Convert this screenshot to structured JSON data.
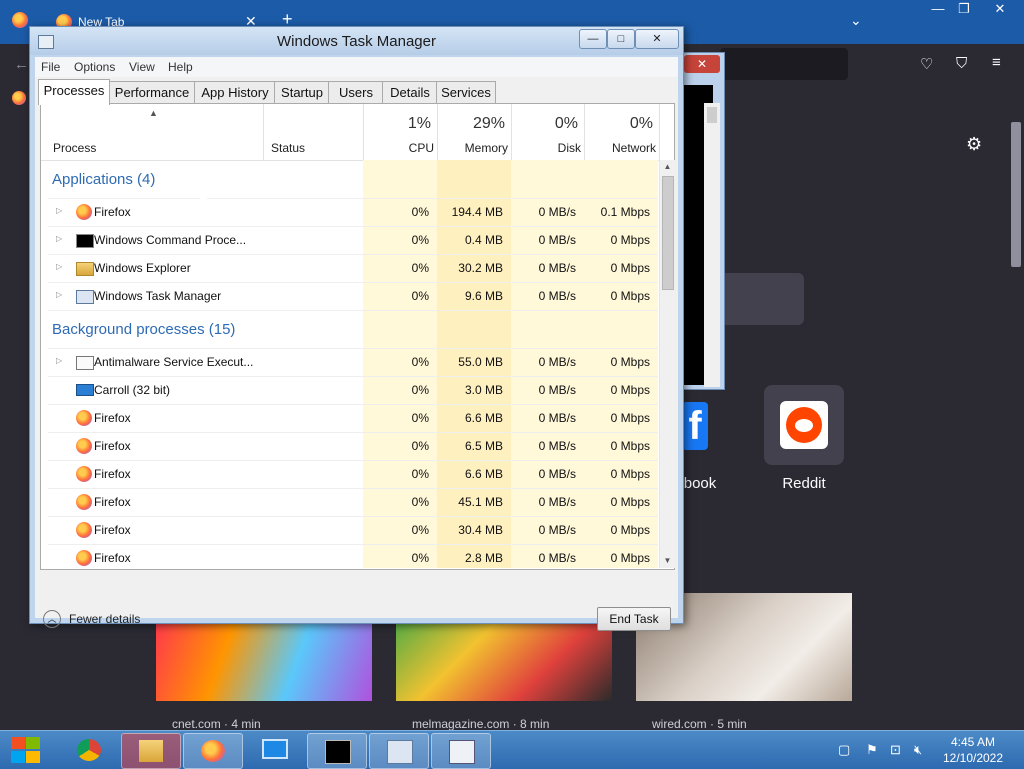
{
  "firefox": {
    "tab_title": "New Tab",
    "tile_reddit": "Reddit",
    "tile_facebook_partial": "book",
    "stories": [
      {
        "source": "cnet.com · 4 min"
      },
      {
        "source": "melmagazine.com · 8 min"
      },
      {
        "source": "wired.com · 5 min"
      }
    ]
  },
  "taskmgr": {
    "title": "Windows Task Manager",
    "menu": [
      "File",
      "Options",
      "View",
      "Help"
    ],
    "tabs": [
      "Processes",
      "Performance",
      "App History",
      "Startup",
      "Users",
      "Details",
      "Services"
    ],
    "columns": {
      "process": "Process",
      "status": "Status",
      "cpu": {
        "pct": "1%",
        "name": "CPU"
      },
      "memory": {
        "pct": "29%",
        "name": "Memory"
      },
      "disk": {
        "pct": "0%",
        "name": "Disk"
      },
      "network": {
        "pct": "0%",
        "name": "Network"
      }
    },
    "groups": {
      "apps": "Applications (4)",
      "background": "Background processes (15)"
    },
    "apps": [
      {
        "name": "Firefox",
        "icon": "firefox-icon",
        "cpu": "0%",
        "mem": "194.4 MB",
        "disk": "0 MB/s",
        "net": "0.1 Mbps"
      },
      {
        "name": "Windows Command Proce...",
        "icon": "cmd-icon",
        "cpu": "0%",
        "mem": "0.4 MB",
        "disk": "0 MB/s",
        "net": "0 Mbps"
      },
      {
        "name": "Windows Explorer",
        "icon": "explorer-icon",
        "cpu": "0%",
        "mem": "30.2 MB",
        "disk": "0 MB/s",
        "net": "0 Mbps"
      },
      {
        "name": "Windows Task Manager",
        "icon": "taskmgr-icon",
        "cpu": "0%",
        "mem": "9.6 MB",
        "disk": "0 MB/s",
        "net": "0 Mbps"
      }
    ],
    "background": [
      {
        "name": "Antimalware Service Execut...",
        "icon": "service-icon",
        "cpu": "0%",
        "mem": "55.0 MB",
        "disk": "0 MB/s",
        "net": "0 Mbps"
      },
      {
        "name": "Carroll (32 bit)",
        "icon": "monitor-icon",
        "cpu": "0%",
        "mem": "3.0 MB",
        "disk": "0 MB/s",
        "net": "0 Mbps"
      },
      {
        "name": "Firefox",
        "icon": "firefox-icon",
        "cpu": "0%",
        "mem": "6.6 MB",
        "disk": "0 MB/s",
        "net": "0 Mbps"
      },
      {
        "name": "Firefox",
        "icon": "firefox-icon",
        "cpu": "0%",
        "mem": "6.5 MB",
        "disk": "0 MB/s",
        "net": "0 Mbps"
      },
      {
        "name": "Firefox",
        "icon": "firefox-icon",
        "cpu": "0%",
        "mem": "6.6 MB",
        "disk": "0 MB/s",
        "net": "0 Mbps"
      },
      {
        "name": "Firefox",
        "icon": "firefox-icon",
        "cpu": "0%",
        "mem": "45.1 MB",
        "disk": "0 MB/s",
        "net": "0 Mbps"
      },
      {
        "name": "Firefox",
        "icon": "firefox-icon",
        "cpu": "0%",
        "mem": "30.4 MB",
        "disk": "0 MB/s",
        "net": "0 Mbps"
      },
      {
        "name": "Firefox",
        "icon": "firefox-icon",
        "cpu": "0%",
        "mem": "2.8 MB",
        "disk": "0 MB/s",
        "net": "0 Mbps"
      }
    ],
    "fewer_details": "Fewer details",
    "end_task": "End Task"
  },
  "taskbar": {
    "time": "4:45 AM",
    "date": "12/10/2022"
  },
  "colors": {
    "heatmap_light": "#fff4c4",
    "heatmap_medium": "#ffe9a6",
    "group_text": "#2e6bb5"
  }
}
